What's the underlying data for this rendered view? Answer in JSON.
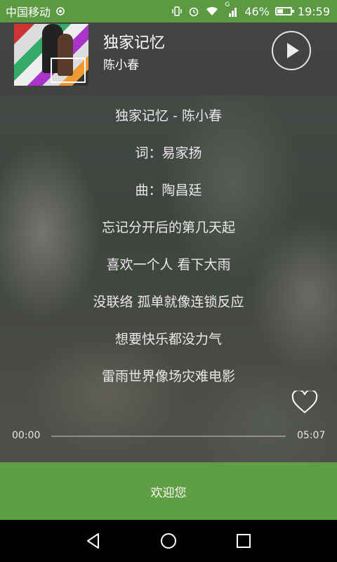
{
  "status_bar": {
    "carrier": "中国移动",
    "network_type": "G",
    "battery_percent": "46%",
    "battery_level": 0.46,
    "time": "19:59"
  },
  "player": {
    "title": "独家记忆",
    "artist": "陈小春",
    "play_icon": "play-icon"
  },
  "lyrics": [
    "独家记忆 - 陈小春",
    "词：易家扬",
    "曲：陶昌廷",
    "忘记分开后的第几天起",
    "喜欢一个人 看下大雨",
    "没联络 孤单就像连锁反应",
    "想要快乐都没力气",
    "雷雨世界像场灾难电影"
  ],
  "progress": {
    "current": "00:00",
    "total": "05:07",
    "fraction": 0.0
  },
  "welcome_label": "欢迎您",
  "colors": {
    "accent": "#5f9f44",
    "status_bar": "#5b9a43"
  }
}
